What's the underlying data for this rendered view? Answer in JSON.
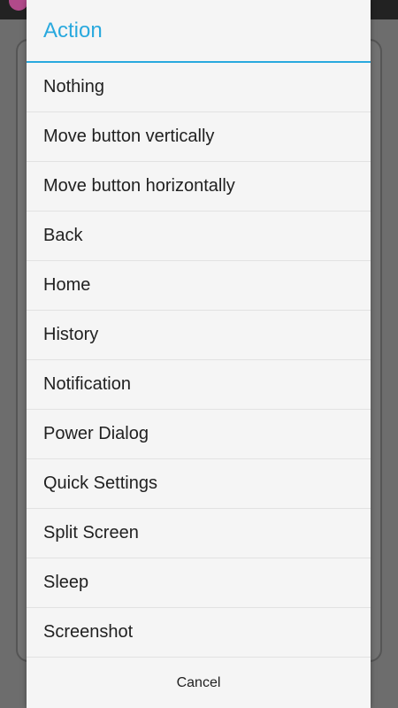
{
  "dialog": {
    "title": "Action",
    "items": [
      {
        "label": "Nothing"
      },
      {
        "label": "Move button vertically"
      },
      {
        "label": "Move button horizontally"
      },
      {
        "label": "Back"
      },
      {
        "label": "Home"
      },
      {
        "label": "History"
      },
      {
        "label": "Notification"
      },
      {
        "label": "Power Dialog"
      },
      {
        "label": "Quick Settings"
      },
      {
        "label": "Split Screen"
      },
      {
        "label": "Sleep"
      },
      {
        "label": "Screenshot"
      }
    ],
    "cancel_label": "Cancel"
  },
  "colors": {
    "accent": "#29a9de",
    "dialog_background": "#f5f5f5",
    "scrim": "#6d6d6d",
    "text": "#212121"
  }
}
